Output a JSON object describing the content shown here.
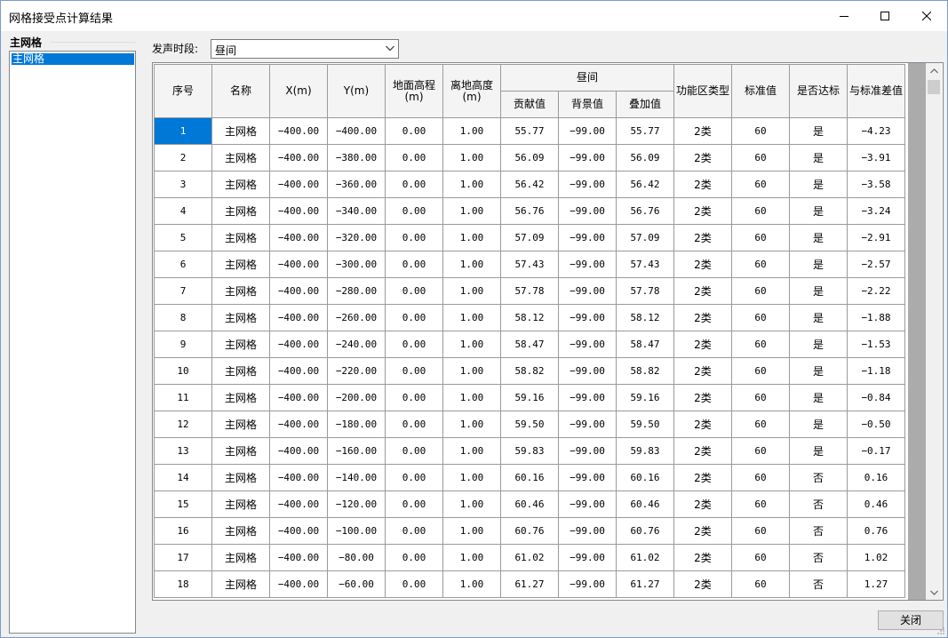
{
  "window": {
    "title": "网格接受点计算结果"
  },
  "tree": {
    "group_label": "主网格",
    "items": [
      {
        "label": "主网格"
      }
    ]
  },
  "period": {
    "label": "发声时段:",
    "selected": "昼间"
  },
  "table": {
    "headers": {
      "seq": "序号",
      "name": "名称",
      "x": "X(m)",
      "y": "Y(m)",
      "ground_elev": "地面高程(m)",
      "height": "离地高度(m)",
      "group": "昼间",
      "contrib": "贡献值",
      "background": "背景值",
      "overlay": "叠加值",
      "zone_type": "功能区类型",
      "standard": "标准值",
      "compliant": "是否达标",
      "diff": "与标准差值"
    },
    "rows": [
      [
        "1",
        "主网格",
        "−400.00",
        "−400.00",
        "0.00",
        "1.00",
        "55.77",
        "−99.00",
        "55.77",
        "2类",
        "60",
        "是",
        "−4.23"
      ],
      [
        "2",
        "主网格",
        "−400.00",
        "−380.00",
        "0.00",
        "1.00",
        "56.09",
        "−99.00",
        "56.09",
        "2类",
        "60",
        "是",
        "−3.91"
      ],
      [
        "3",
        "主网格",
        "−400.00",
        "−360.00",
        "0.00",
        "1.00",
        "56.42",
        "−99.00",
        "56.42",
        "2类",
        "60",
        "是",
        "−3.58"
      ],
      [
        "4",
        "主网格",
        "−400.00",
        "−340.00",
        "0.00",
        "1.00",
        "56.76",
        "−99.00",
        "56.76",
        "2类",
        "60",
        "是",
        "−3.24"
      ],
      [
        "5",
        "主网格",
        "−400.00",
        "−320.00",
        "0.00",
        "1.00",
        "57.09",
        "−99.00",
        "57.09",
        "2类",
        "60",
        "是",
        "−2.91"
      ],
      [
        "6",
        "主网格",
        "−400.00",
        "−300.00",
        "0.00",
        "1.00",
        "57.43",
        "−99.00",
        "57.43",
        "2类",
        "60",
        "是",
        "−2.57"
      ],
      [
        "7",
        "主网格",
        "−400.00",
        "−280.00",
        "0.00",
        "1.00",
        "57.78",
        "−99.00",
        "57.78",
        "2类",
        "60",
        "是",
        "−2.22"
      ],
      [
        "8",
        "主网格",
        "−400.00",
        "−260.00",
        "0.00",
        "1.00",
        "58.12",
        "−99.00",
        "58.12",
        "2类",
        "60",
        "是",
        "−1.88"
      ],
      [
        "9",
        "主网格",
        "−400.00",
        "−240.00",
        "0.00",
        "1.00",
        "58.47",
        "−99.00",
        "58.47",
        "2类",
        "60",
        "是",
        "−1.53"
      ],
      [
        "10",
        "主网格",
        "−400.00",
        "−220.00",
        "0.00",
        "1.00",
        "58.82",
        "−99.00",
        "58.82",
        "2类",
        "60",
        "是",
        "−1.18"
      ],
      [
        "11",
        "主网格",
        "−400.00",
        "−200.00",
        "0.00",
        "1.00",
        "59.16",
        "−99.00",
        "59.16",
        "2类",
        "60",
        "是",
        "−0.84"
      ],
      [
        "12",
        "主网格",
        "−400.00",
        "−180.00",
        "0.00",
        "1.00",
        "59.50",
        "−99.00",
        "59.50",
        "2类",
        "60",
        "是",
        "−0.50"
      ],
      [
        "13",
        "主网格",
        "−400.00",
        "−160.00",
        "0.00",
        "1.00",
        "59.83",
        "−99.00",
        "59.83",
        "2类",
        "60",
        "是",
        "−0.17"
      ],
      [
        "14",
        "主网格",
        "−400.00",
        "−140.00",
        "0.00",
        "1.00",
        "60.16",
        "−99.00",
        "60.16",
        "2类",
        "60",
        "否",
        "0.16"
      ],
      [
        "15",
        "主网格",
        "−400.00",
        "−120.00",
        "0.00",
        "1.00",
        "60.46",
        "−99.00",
        "60.46",
        "2类",
        "60",
        "否",
        "0.46"
      ],
      [
        "16",
        "主网格",
        "−400.00",
        "−100.00",
        "0.00",
        "1.00",
        "60.76",
        "−99.00",
        "60.76",
        "2类",
        "60",
        "否",
        "0.76"
      ],
      [
        "17",
        "主网格",
        "−400.00",
        "−80.00",
        "0.00",
        "1.00",
        "61.02",
        "−99.00",
        "61.02",
        "2类",
        "60",
        "否",
        "1.02"
      ],
      [
        "18",
        "主网格",
        "−400.00",
        "−60.00",
        "0.00",
        "1.00",
        "61.27",
        "−99.00",
        "61.27",
        "2类",
        "60",
        "否",
        "1.27"
      ]
    ]
  },
  "buttons": {
    "close": "关闭"
  },
  "colors": {
    "selection": "#0078d7",
    "header_bg": "#f4f4f4",
    "grid_line": "#9a9a9a"
  },
  "icons": {
    "minimize": "minimize-icon",
    "maximize": "maximize-icon",
    "close": "close-icon",
    "dropdown": "chevron-down-icon",
    "scroll_up": "scroll-up-icon",
    "scroll_down": "scroll-down-icon"
  }
}
